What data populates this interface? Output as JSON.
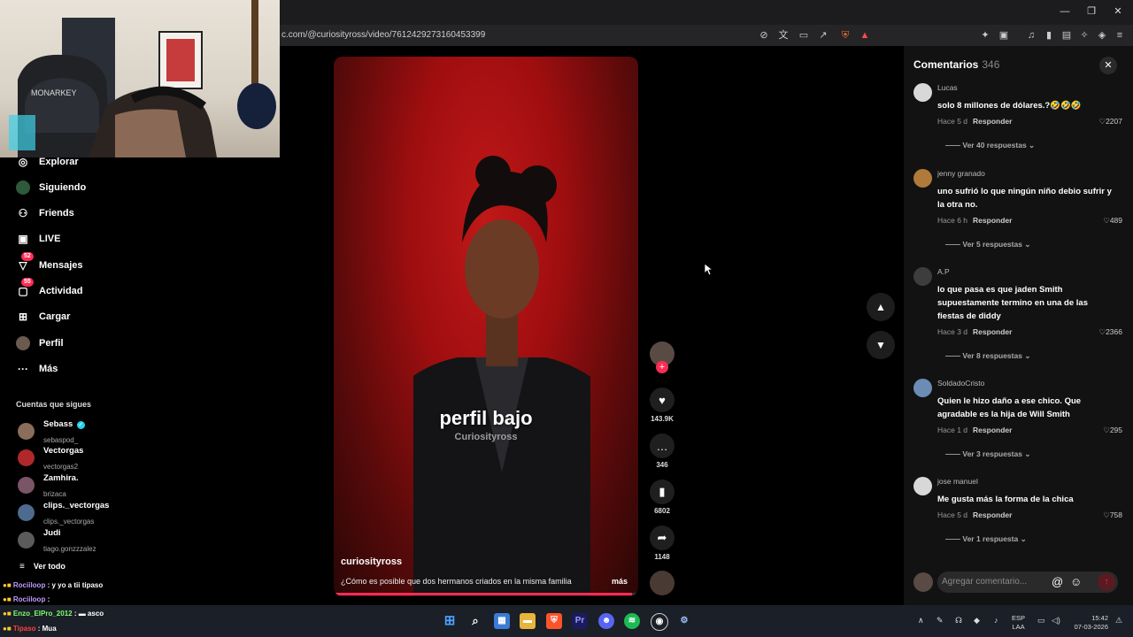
{
  "browser": {
    "url": "c.com/@curiosityross/video/7612429273160453399",
    "window_controls": [
      "minimize-icon",
      "restore-icon",
      "close-icon"
    ]
  },
  "sidebar": {
    "items": [
      {
        "label": "Explorar",
        "icon": "compass-icon",
        "badge": ""
      },
      {
        "label": "Siguiendo",
        "icon": "following-icon",
        "badge": ""
      },
      {
        "label": "Friends",
        "icon": "friends-icon",
        "badge": ""
      },
      {
        "label": "LIVE",
        "icon": "live-icon",
        "badge": ""
      },
      {
        "label": "Mensajes",
        "icon": "messages-icon",
        "badge": "52"
      },
      {
        "label": "Actividad",
        "icon": "activity-icon",
        "badge": "55"
      },
      {
        "label": "Cargar",
        "icon": "upload-icon",
        "badge": ""
      },
      {
        "label": "Perfil",
        "icon": "profile-icon",
        "badge": ""
      },
      {
        "label": "Más",
        "icon": "more-icon",
        "badge": ""
      }
    ],
    "following_title": "Cuentas que sigues",
    "accounts": [
      {
        "name": "Sebass",
        "handle": "sebaspod_",
        "verified": true,
        "color": "#8a6d5a"
      },
      {
        "name": "Vectorgas",
        "handle": "vectorgas2",
        "verified": false,
        "color": "#b0282a"
      },
      {
        "name": "Zamhira.",
        "handle": "brizaca",
        "verified": false,
        "color": "#7a5566"
      },
      {
        "name": "clips._vectorgas",
        "handle": "clips._vectorgas",
        "verified": false,
        "color": "#4d6b8f"
      },
      {
        "name": "Judi",
        "handle": "tiago.gonzzzalez",
        "verified": false,
        "color": "#5b5b5b"
      }
    ],
    "see_all": "Ver todo"
  },
  "stream_chat": [
    {
      "user": "Rociiloop",
      "text": " : y yo a tii tipaso",
      "color": "#c09bff"
    },
    {
      "user": "Rociiloop",
      "text": " : ",
      "color": "#c09bff"
    },
    {
      "user": "Enzo_ElPro_2012",
      "text": " : ▬ asco",
      "color": "#7bff6b"
    },
    {
      "user": "Tipaso",
      "text": " : Mua",
      "color": "#ff4040"
    }
  ],
  "video": {
    "overlay_text": "perfil bajo",
    "overlay_sub": "Curiosityross",
    "author": "curiosityross",
    "description": "¿Cómo es posible que dos hermanos criados en la misma familia",
    "more": "más",
    "progress": 0.98
  },
  "actions": {
    "likes": "143.9K",
    "comments": "346",
    "saves": "6802",
    "shares": "1148"
  },
  "comments_panel": {
    "title": "Comentarios",
    "count": "346",
    "input_placeholder": "Agregar comentario...",
    "items": [
      {
        "user": "Lucas",
        "text": "solo 8 millones de dólares.?🤣🤣🤣",
        "time": "Hace 5 d",
        "reply": "Responder",
        "likes": "2207",
        "replies": "Ver 40 respuestas",
        "color": "#d8d8d8"
      },
      {
        "user": "jenny granado",
        "text": "uno sufrió lo que ningún niño debio sufrir y la otra no.",
        "time": "Hace 6 h",
        "reply": "Responder",
        "likes": "489",
        "replies": "Ver 5 respuestas",
        "color": "#b07a3a"
      },
      {
        "user": "A.P",
        "text": "lo que pasa es que jaden Smith supuestamente termino en una de las fiestas de diddy",
        "time": "Hace 3 d",
        "reply": "Responder",
        "likes": "2366",
        "replies": "Ver 8 respuestas",
        "color": "#3d3d3d"
      },
      {
        "user": "SoldadoCristo",
        "text": "Quien le hizo daño a ese chico. Que agradable es la hija de Will Smith",
        "time": "Hace 1 d",
        "reply": "Responder",
        "likes": "295",
        "replies": "Ver 3 respuestas",
        "color": "#6a8cb5"
      },
      {
        "user": "jose manuel",
        "text": "Me gusta más la forma de la chica",
        "time": "Hace 5 d",
        "reply": "Responder",
        "likes": "758",
        "replies": "Ver 1 respuesta",
        "color": "#d8d8d8"
      }
    ]
  },
  "taskbar": {
    "lang": "ESP",
    "lang2": "LAA",
    "time": "15:42",
    "date": "07-03-2026"
  }
}
